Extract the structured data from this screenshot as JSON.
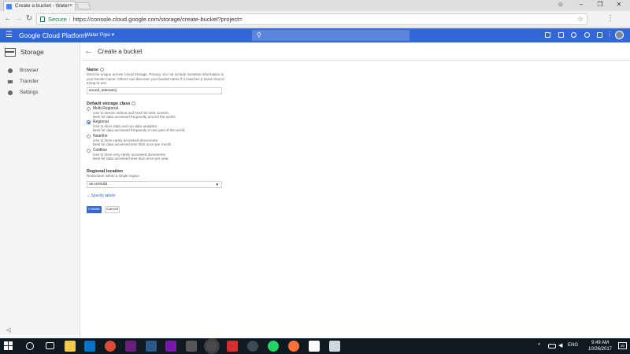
{
  "browser": {
    "tab_title": "Create a bucket - Water",
    "secure_label": "Secure",
    "url": "https://console.cloud.google.com/storage/create-bucket?project=",
    "window_user_icon": "person-icon"
  },
  "gcp_header": {
    "brand": "Google Cloud Platform",
    "project": "Water Pipe ▾",
    "search_icon": "search-icon"
  },
  "leftnav": {
    "title": "Storage",
    "items": [
      {
        "label": "Browser",
        "icon": "browser-icon"
      },
      {
        "label": "Transfer",
        "icon": "transfer-icon"
      },
      {
        "label": "Settings",
        "icon": "settings-icon"
      }
    ],
    "collapse": "<|"
  },
  "main": {
    "title": "Create a bucket",
    "name": {
      "label": "Name",
      "description": "Must be unique across Cloud Storage. Privacy: Do not include sensitive information in your bucket name. Others can discover your bucket name if it matches a name they're trying to use.",
      "value": "sound_telemetry"
    },
    "storage_class": {
      "label": "Default storage class",
      "options": [
        {
          "label": "Multi-Regional",
          "line1": "Use to stream videos and host hot web content.",
          "line2": "Best for data accessed frequently around the world.",
          "selected": false
        },
        {
          "label": "Regional",
          "line1": "Use to store data and run data analytics.",
          "line2": "Best for data accessed frequently in one part of the world.",
          "selected": true
        },
        {
          "label": "Nearline",
          "line1": "Use to store rarely accessed documents.",
          "line2": "Best for data accessed less than once per month.",
          "selected": false
        },
        {
          "label": "Coldline",
          "line1": "Use to store very rarely accessed documents.",
          "line2": "Best for data accessed less than once per year.",
          "selected": false
        }
      ]
    },
    "location": {
      "label": "Regional location",
      "description": "Redundant within a single region",
      "value": "us-central1"
    },
    "labels_link": "Specify labels",
    "create_label": "Create",
    "cancel_label": "Cancel"
  },
  "taskbar": {
    "language": "ENG",
    "time": "9:49 AM",
    "date": "10/26/2017",
    "notifications": "20"
  }
}
